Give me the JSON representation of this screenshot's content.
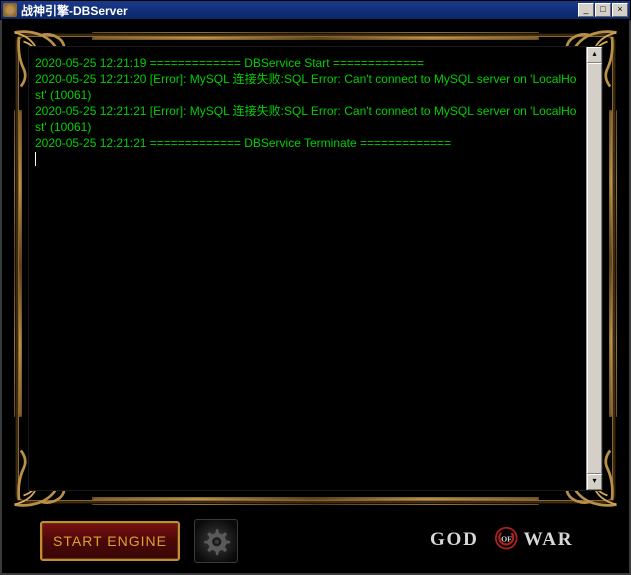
{
  "titlebar": {
    "title": "战神引擎-DBServer"
  },
  "log": {
    "lines": [
      "2020-05-25 12:21:19 ============= DBService Start =============",
      "2020-05-25 12:21:20 [Error]: MySQL 连接失败:SQL Error: Can't connect to MySQL server on 'LocalHost' (10061)",
      "2020-05-25 12:21:21 [Error]: MySQL 连接失败:SQL Error: Can't connect to MySQL server on 'LocalHost' (10061)",
      "2020-05-25 12:21:21 ============= DBService Terminate ============="
    ]
  },
  "buttons": {
    "start_engine": "START ENGINE"
  },
  "logo": {
    "left": "GOD",
    "of": "OF",
    "right": "WAR"
  },
  "colors": {
    "log_text": "#00d000",
    "gold": "#c9a050",
    "button_border": "#c78a30",
    "button_bg": "#5a0c0c"
  }
}
